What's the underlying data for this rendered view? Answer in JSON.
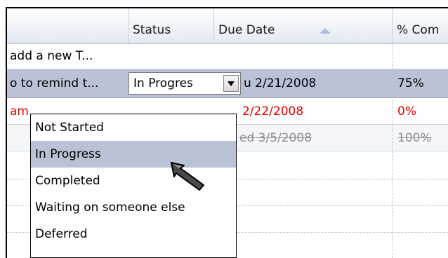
{
  "columns": {
    "status": "Status",
    "due_date": "Due Date",
    "percent_complete": "% Com"
  },
  "new_task_placeholder": "add a new T...",
  "tasks": [
    {
      "subject": "o to remind t...",
      "status": "In Progres",
      "due_date": "u 2/21/2008",
      "percent": "75%"
    },
    {
      "subject": "am",
      "due_date": "2/22/2008",
      "percent": "0%"
    },
    {
      "due_date": "ed 3/5/2008",
      "percent": "100%"
    }
  ],
  "status_options": [
    "Not Started",
    "In Progress",
    "Completed",
    "Waiting on someone else",
    "Deferred"
  ],
  "highlighted_option": "In Progress",
  "colors": {
    "selected_row": "#b9c3d5",
    "overdue_text": "#e00000",
    "completed_text": "#8e8e8e"
  },
  "icons": {
    "sort": "sort-ascending-icon",
    "dropdown": "chevron-down-icon",
    "cursor": "mouse-pointer-icon"
  }
}
